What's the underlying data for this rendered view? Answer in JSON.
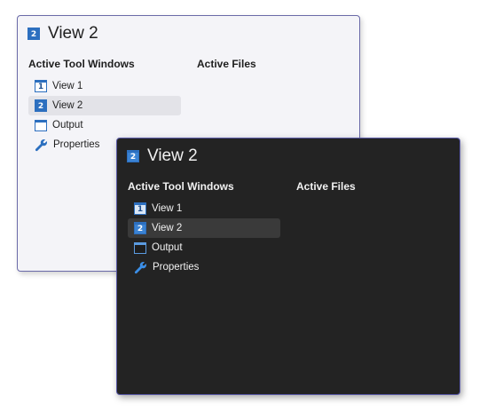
{
  "light_switcher": {
    "title": "View 2",
    "title_icon_number": "2",
    "tool_windows_header": "Active Tool Windows",
    "files_header": "Active Files",
    "tools": [
      {
        "label": "View 1",
        "icon": "view-1-icon",
        "icon_number": "1"
      },
      {
        "label": "View 2",
        "icon": "view-2-icon",
        "icon_number": "2"
      },
      {
        "label": "Output",
        "icon": "output-window-icon"
      },
      {
        "label": "Properties",
        "icon": "wrench-icon"
      }
    ],
    "selected_tool": "View 2"
  },
  "dark_switcher": {
    "title": "View 2",
    "title_icon_number": "2",
    "tool_windows_header": "Active Tool Windows",
    "files_header": "Active Files",
    "tools": [
      {
        "label": "View 1",
        "icon": "view-1-icon",
        "icon_number": "1"
      },
      {
        "label": "View 2",
        "icon": "view-2-icon",
        "icon_number": "2"
      },
      {
        "label": "Output",
        "icon": "output-window-icon"
      },
      {
        "label": "Properties",
        "icon": "wrench-icon"
      }
    ],
    "selected_tool": "View 2"
  },
  "colors": {
    "light_background": "#f4f4f8",
    "light_border": "#6a6aa8",
    "dark_background": "#232323",
    "dark_border": "#5a5aa8",
    "icon_accent": "#2c6fbf",
    "light_selection": "#e3e3e8",
    "dark_selection": "#3a3a3a"
  }
}
